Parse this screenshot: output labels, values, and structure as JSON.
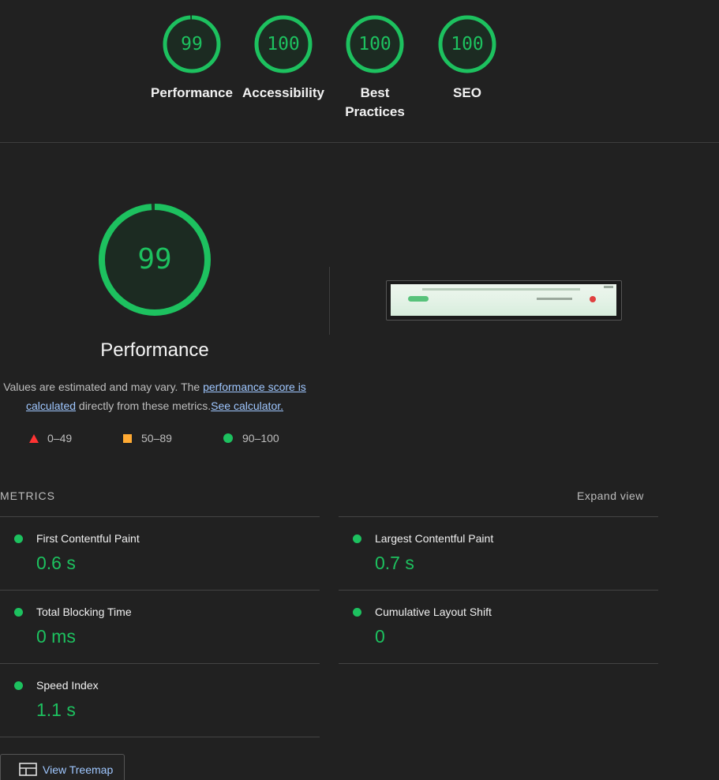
{
  "colors": {
    "pass": "#1dc15f",
    "average": "#ffaa33",
    "fail": "#ff3333",
    "background": "#212121",
    "link": "#9fc7ff"
  },
  "categories": [
    {
      "score": "99",
      "score_value": 99,
      "label": "Performance"
    },
    {
      "score": "100",
      "score_value": 100,
      "label": "Accessibility"
    },
    {
      "score": "100",
      "score_value": 100,
      "label": "Best Practices"
    },
    {
      "score": "100",
      "score_value": 100,
      "label": "SEO"
    }
  ],
  "performance": {
    "score": "99",
    "score_value": 99,
    "title": "Performance",
    "desc_prefix": "Values are estimated and may vary. The ",
    "link_score": "performance score is calculated",
    "desc_middle": " directly from these metrics.",
    "link_calculator": "See calculator."
  },
  "legend": {
    "fail": "0–49",
    "average": "50–89",
    "pass": "90–100"
  },
  "metrics": {
    "header": "METRICS",
    "expand": "Expand view",
    "items": [
      {
        "title": "First Contentful Paint",
        "value": "0.6 s"
      },
      {
        "title": "Largest Contentful Paint",
        "value": "0.7 s"
      },
      {
        "title": "Total Blocking Time",
        "value": "0 ms"
      },
      {
        "title": "Cumulative Layout Shift",
        "value": "0"
      },
      {
        "title": "Speed Index",
        "value": "1.1 s"
      }
    ]
  },
  "treemap": {
    "label": "View Treemap",
    "icon": "treemap-icon"
  }
}
